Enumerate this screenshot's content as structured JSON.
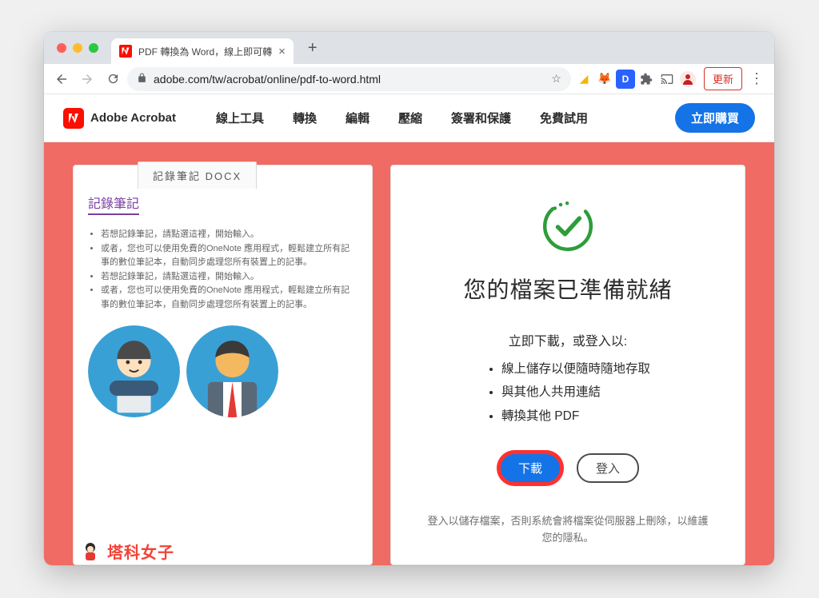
{
  "browser_tab": {
    "title": "PDF 轉換為 Word，線上即可轉",
    "favicon_letter": "A"
  },
  "toolbar": {
    "url": "adobe.com/tw/acrobat/online/pdf-to-word.html",
    "update_label": "更新"
  },
  "site_nav": {
    "brand": "Adobe Acrobat",
    "items": [
      "線上工具",
      "轉換",
      "編輯",
      "壓縮",
      "簽署和保護",
      "免費試用"
    ],
    "buy": "立即購買"
  },
  "left_card": {
    "file_tab": "記錄筆記   DOCX",
    "doc_title": "記錄筆記",
    "bullets": [
      "若想記錄筆記，請點選這裡，開始輸入。",
      "或者，您也可以使用免費的OneNote 應用程式，輕鬆建立所有記事的數位筆記本，自動同步處理您所有裝置上的記事。",
      "若想記錄筆記，請點選這裡，開始輸入。",
      "或者，您也可以使用免費的OneNote 應用程式，輕鬆建立所有記事的數位筆記本，自動同步處理您所有裝置上的記事。"
    ],
    "watermark": "塔科女子"
  },
  "right_card": {
    "title": "您的檔案已準備就緒",
    "subtitle": "立即下載，或登入以:",
    "features": [
      "線上儲存以便隨時隨地存取",
      "與其他人共用連結",
      "轉換其他 PDF"
    ],
    "download": "下載",
    "signin": "登入",
    "privacy": "登入以儲存檔案，否則系統會將檔案從伺服器上刪除，以維護您的隱私。"
  }
}
